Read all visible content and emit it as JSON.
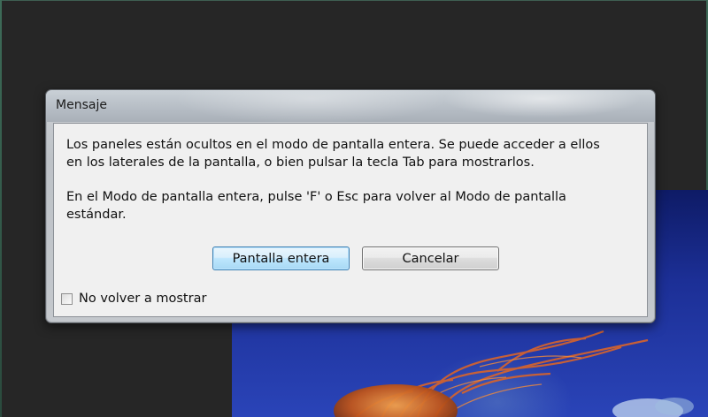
{
  "dialog": {
    "title": "Mensaje",
    "message_line1": "Los paneles están ocultos en el modo de pantalla entera. Se puede acceder a ellos\nen los laterales de la pantalla, o bien pulsar la tecla Tab para mostrarlos.",
    "message_line2": " En el Modo de pantalla entera, pulse 'F' o Esc para volver al Modo de pantalla\nestándar.",
    "buttons": {
      "primary_label": "Pantalla entera",
      "cancel_label": "Cancelar"
    },
    "checkbox": {
      "label": "No volver a mostrar",
      "checked": false
    }
  },
  "colors": {
    "workspace_background": "#262626",
    "dialog_client": "#f0f0f0",
    "primary_button_border": "#3c7fb1",
    "photo_blue": "#1c2f96"
  }
}
